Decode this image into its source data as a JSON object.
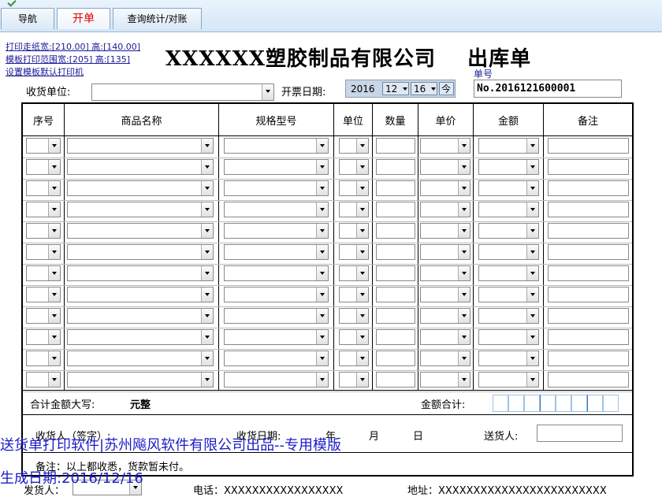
{
  "tabs": [
    {
      "label": "导航"
    },
    {
      "label": "开单"
    },
    {
      "label": "查询统计/对账"
    }
  ],
  "print_links": {
    "paper_size": "打印走纸宽:[210.00] 高:[140.00]",
    "template_range": "模板打印范围宽:[205] 高:[135]",
    "default_printer": "设置模板默认打印机"
  },
  "header": {
    "company": "XXXXXX塑胶制品有限公司",
    "doc_type": "出库单",
    "order_no_label": "单号",
    "order_no": "No.2016121600001"
  },
  "form": {
    "consignee_label": "收货单位:",
    "consignee_value": "",
    "date_label": "开票日期:",
    "date_year": "2016",
    "date_month": "12",
    "date_day": "16",
    "today_button": "今"
  },
  "table": {
    "columns": [
      "序号",
      "商品名称",
      "规格型号",
      "单位",
      "数量",
      "单价",
      "金额",
      "备注"
    ],
    "row_count": 12
  },
  "totals": {
    "amount_in_words_label": "合计金额大写:",
    "amount_in_words_value": "元整",
    "amount_total_label": "金额合计:"
  },
  "footer": {
    "receiver_label": "收货人（签字）:",
    "receive_date_label": "收货日期:",
    "year": "年",
    "month": "月",
    "day": "日",
    "deliverer_label": "送货人:",
    "remark": "备注：以上都收悉，货款暂未付。",
    "partial_left": "发货人：",
    "phone": "电话：XXXXXXXXXXXXXXXXX",
    "address": "地址：XXXXXXXXXXXXXXXXXXXXXXXX"
  },
  "watermark": {
    "line1": "送货单打印软件|苏州飚风软件有限公司出品--专用模版",
    "line2": "生成日期:2016/12/16"
  }
}
